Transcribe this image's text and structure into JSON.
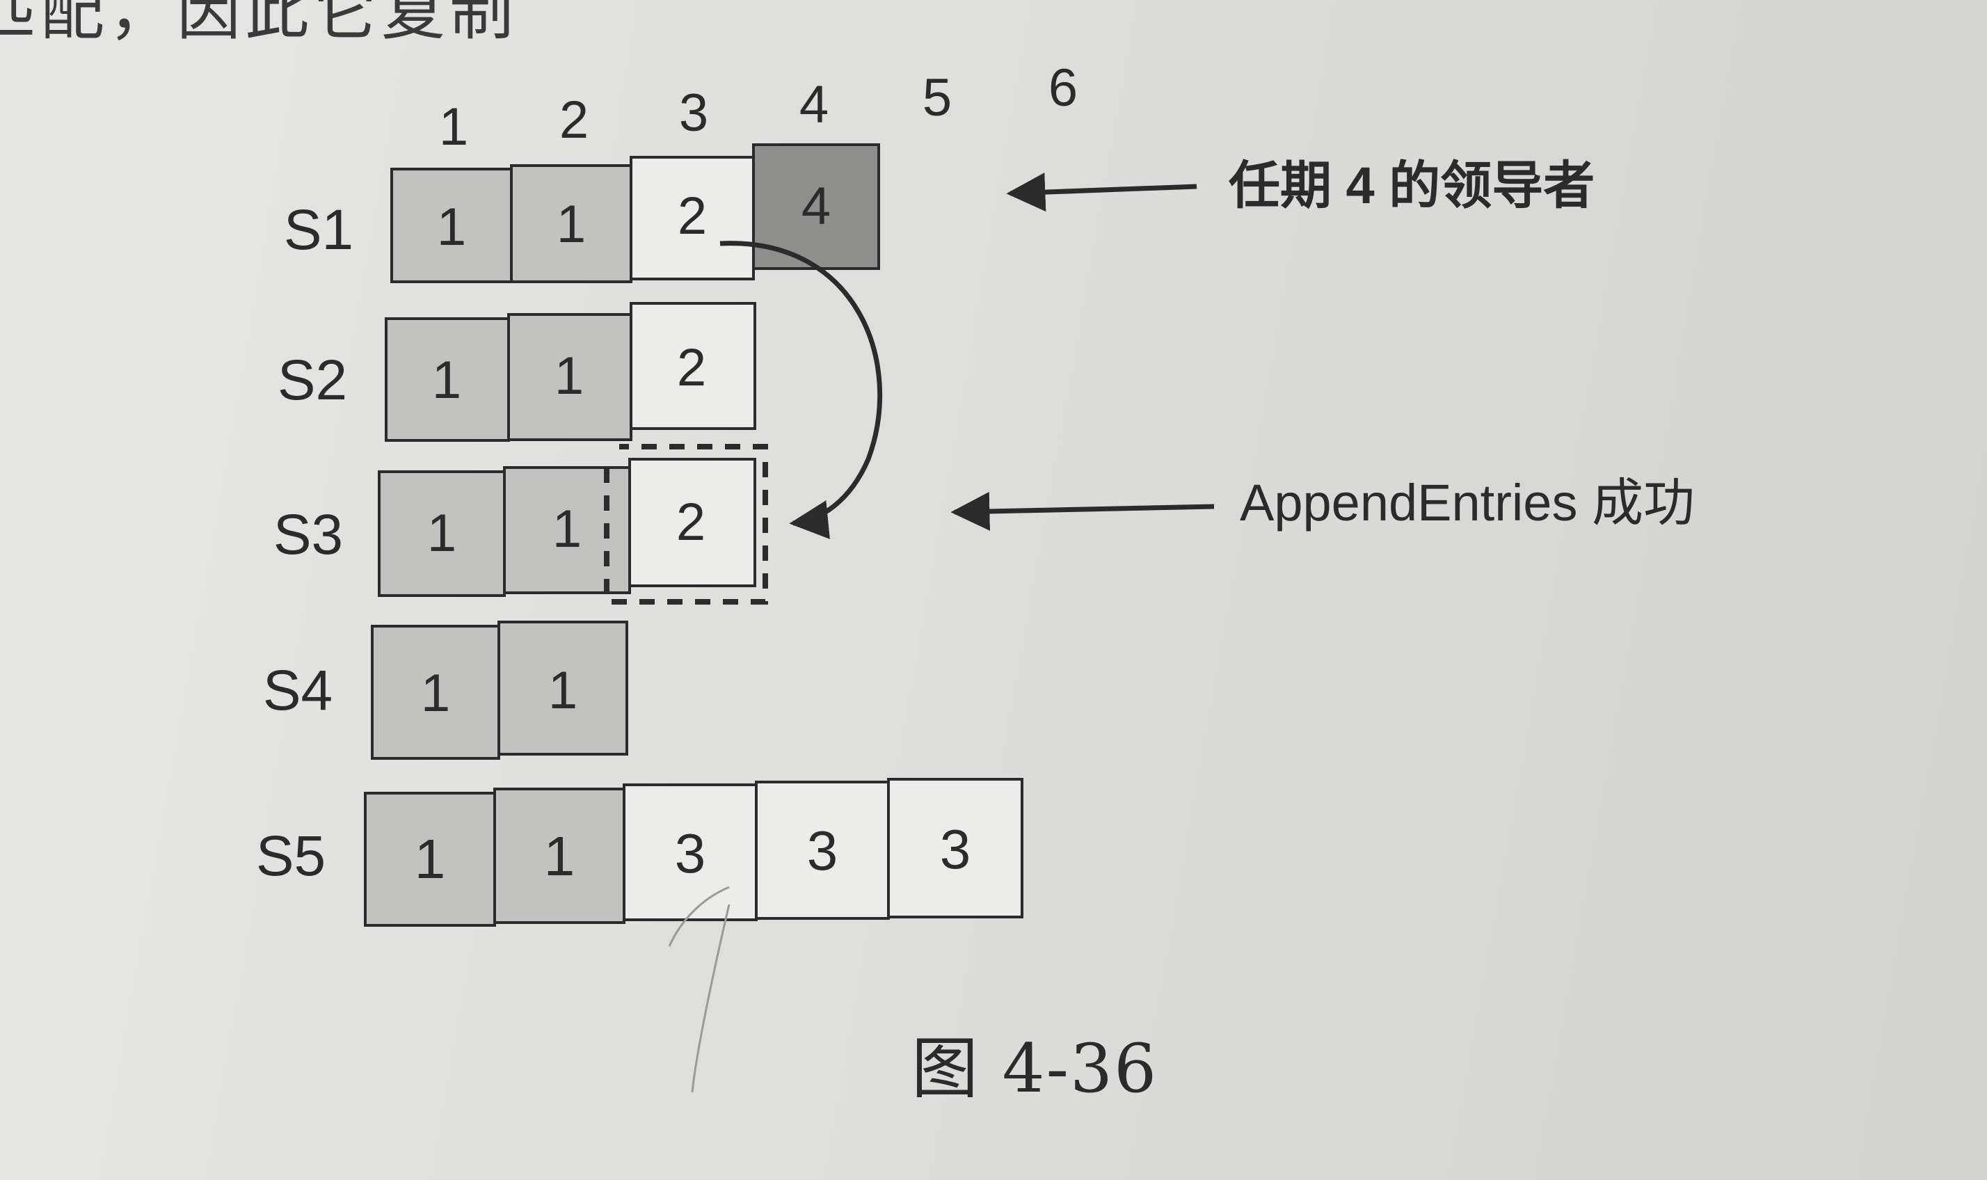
{
  "page": {
    "top_text": "匹配，因此它复制"
  },
  "figure": {
    "caption": "图 4-36",
    "column_indices": [
      "1",
      "2",
      "3",
      "4",
      "5",
      "6"
    ],
    "servers": [
      {
        "name": "S1",
        "terms": [
          "1",
          "1",
          "2",
          "4"
        ]
      },
      {
        "name": "S2",
        "terms": [
          "1",
          "1",
          "2"
        ]
      },
      {
        "name": "S3",
        "terms": [
          "1",
          "1",
          "2"
        ]
      },
      {
        "name": "S4",
        "terms": [
          "1",
          "1"
        ]
      },
      {
        "name": "S5",
        "terms": [
          "1",
          "1",
          "3",
          "3",
          "3"
        ]
      }
    ],
    "annotations": {
      "leader": "任期 4 的领导者",
      "append": "AppendEntries 成功"
    },
    "colors": {
      "committed_fill": "#c2c2c0",
      "leader_fill": "#8e8e8c",
      "plain_fill": "#ececea",
      "stroke": "#2b2b2b"
    }
  }
}
